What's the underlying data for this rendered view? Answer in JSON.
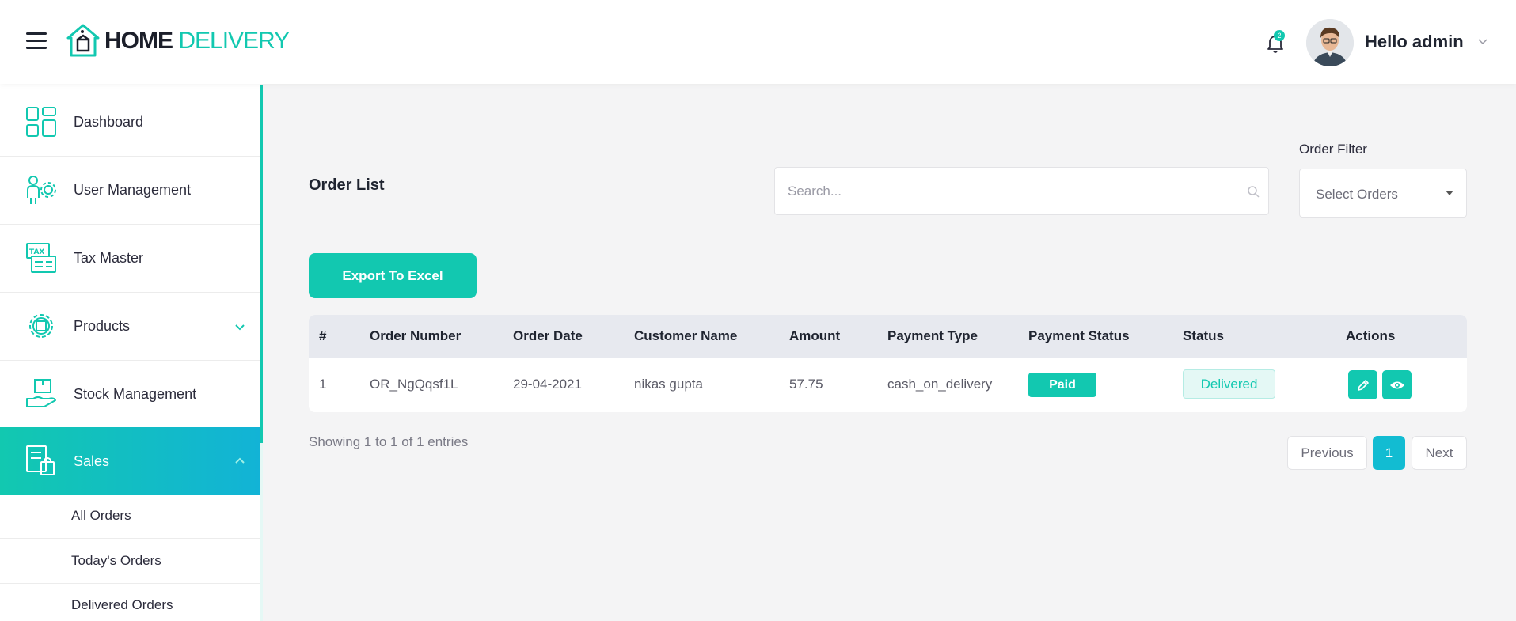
{
  "header": {
    "logo_home": "HOME",
    "logo_delivery": "DELIVERY",
    "notification_count": "2",
    "greeting": "Hello admin"
  },
  "sidebar": {
    "items": [
      {
        "label": "Dashboard",
        "icon": "dashboard-icon"
      },
      {
        "label": "User Management",
        "icon": "user-gear-icon"
      },
      {
        "label": "Tax Master",
        "icon": "tax-icon"
      },
      {
        "label": "Products",
        "icon": "gear-box-icon",
        "expanded": false
      },
      {
        "label": "Stock Management",
        "icon": "stock-icon"
      },
      {
        "label": "Sales",
        "icon": "sales-bag-icon",
        "expanded": true,
        "active": true
      }
    ],
    "sub_items": [
      {
        "label": "All Orders"
      },
      {
        "label": "Today's Orders"
      },
      {
        "label": "Delivered Orders"
      }
    ]
  },
  "main": {
    "title": "Order List",
    "search_placeholder": "Search...",
    "filter_label": "Order Filter",
    "filter_value": "Select Orders",
    "export_label": "Export To Excel",
    "table": {
      "headers": [
        "#",
        "Order Number",
        "Order Date",
        "Customer Name",
        "Amount",
        "Payment Type",
        "Payment Status",
        "Status",
        "Actions"
      ],
      "rows": [
        {
          "index": "1",
          "order_number": "OR_NgQqsf1L",
          "order_date": "29-04-2021",
          "customer_name": "nikas gupta",
          "amount": "57.75",
          "payment_type": "cash_on_delivery",
          "payment_status": "Paid",
          "status": "Delivered"
        }
      ]
    },
    "entries_info": "Showing 1 to 1 of 1 entries",
    "pagination": {
      "previous": "Previous",
      "current": "1",
      "next": "Next"
    }
  },
  "colors": {
    "accent": "#12c8b0",
    "accent_blue": "#12b3d6",
    "page_bg": "#f4f4f5"
  }
}
